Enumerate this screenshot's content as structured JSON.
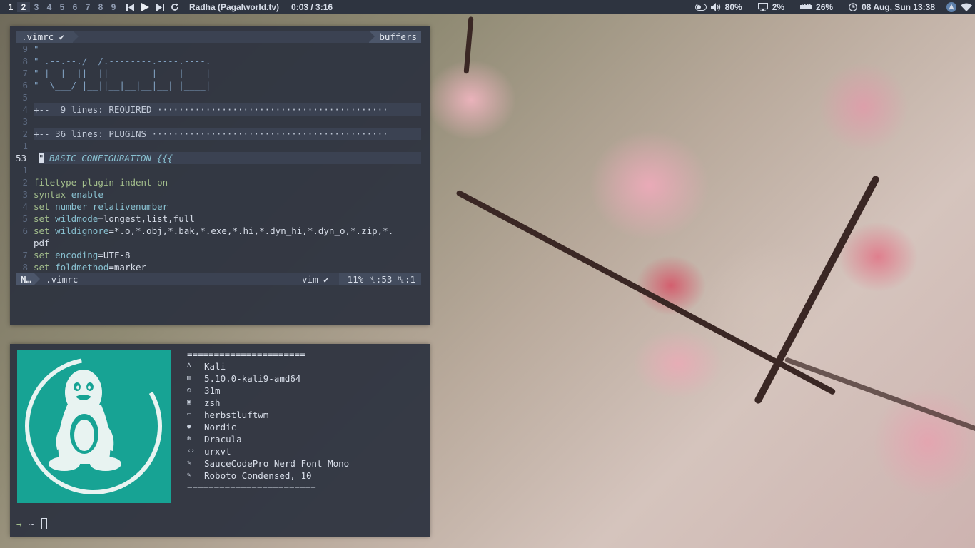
{
  "topbar": {
    "tags": [
      "1",
      "2",
      "3",
      "4",
      "5",
      "6",
      "7",
      "8",
      "9"
    ],
    "current_tag": "2",
    "now_playing": "Radha (Pagalworld.tv)",
    "playback_time": "0:03 / 3:16",
    "volume": "80%",
    "cpu": "2%",
    "memory": "26%",
    "datetime": "08 Aug, Sun 13:38",
    "icons": [
      "prev-icon",
      "play-icon",
      "next-icon",
      "repeat-icon",
      "toggle-icon",
      "volume-icon",
      "monitor-icon",
      "memory-icon",
      "clock-icon",
      "arch-icon",
      "wifi-icon"
    ]
  },
  "vim": {
    "tab_file": ".vimrc",
    "tab_buffers": "buffers",
    "lines": [
      {
        "n": "9",
        "cls": "c-cmt",
        "t": "\"          __"
      },
      {
        "n": "8",
        "cls": "c-cmt",
        "t": "\" .--.--./__/.--------.----.----."
      },
      {
        "n": "7",
        "cls": "c-cmt",
        "t": "\" |  |  ||  ||        |   _|  __|"
      },
      {
        "n": "6",
        "cls": "c-cmt",
        "t": "\"  \\___/ |__||__|__|__|__| |____|"
      },
      {
        "n": "5",
        "cls": "",
        "t": ""
      },
      {
        "n": "4",
        "cls": "c-fold",
        "t": "+--  9 lines: REQUIRED ···········································"
      },
      {
        "n": "3",
        "cls": "",
        "t": ""
      },
      {
        "n": "2",
        "cls": "c-fold",
        "t": "+-- 36 lines: PLUGINS ············································"
      },
      {
        "n": "1",
        "cls": "",
        "t": ""
      },
      {
        "n": "53",
        "cls": "c-head",
        "t": "\" BASIC CONFIGURATION {{{",
        "cur": true
      },
      {
        "n": "1",
        "cls": "",
        "t": ""
      },
      {
        "n": "2",
        "cls": "",
        "t": "filetype plugin indent on"
      },
      {
        "n": "3",
        "cls": "",
        "t": "syntax enable"
      },
      {
        "n": "4",
        "cls": "",
        "t": "set number relativenumber"
      },
      {
        "n": "5",
        "cls": "",
        "t": "set wildmode=longest,list,full"
      },
      {
        "n": "6",
        "cls": "",
        "t": "set wildignore=*.o,*.obj,*.bak,*.exe,*.hi,*.dyn_hi,*.dyn_o,*.zip,*."
      },
      {
        "n": "",
        "cls": "",
        "t": "pdf"
      },
      {
        "n": "7",
        "cls": "",
        "t": "set encoding=UTF-8"
      },
      {
        "n": "8",
        "cls": "",
        "t": "set foldmethod=marker"
      }
    ],
    "status_mode": "N…",
    "status_file": ".vimrc",
    "status_filetype": "vim",
    "status_percent": "11%",
    "status_line": "53",
    "status_col": "1"
  },
  "neofetch": {
    "separator_top": "======================",
    "separator_bottom": "========================",
    "rows": [
      {
        "icon": "os-icon",
        "value": "Kali"
      },
      {
        "icon": "kernel-icon",
        "value": "5.10.0-kali9-amd64"
      },
      {
        "icon": "uptime-icon",
        "value": "31m"
      },
      {
        "icon": "shell-icon",
        "value": "zsh"
      },
      {
        "icon": "wm-icon",
        "value": "herbstluftwm"
      },
      {
        "icon": "theme-icon",
        "value": "Nordic"
      },
      {
        "icon": "icons-icon",
        "value": "Dracula"
      },
      {
        "icon": "terminal-icon",
        "value": "urxvt"
      },
      {
        "icon": "font-icon",
        "value": "SauceCodePro Nerd Font Mono"
      },
      {
        "icon": "font-icon",
        "value": "Roboto Condensed, 10"
      }
    ],
    "prompt_symbol": "→",
    "prompt_dir": "~",
    "colors": {
      "logo_bg": "#17a394"
    }
  }
}
